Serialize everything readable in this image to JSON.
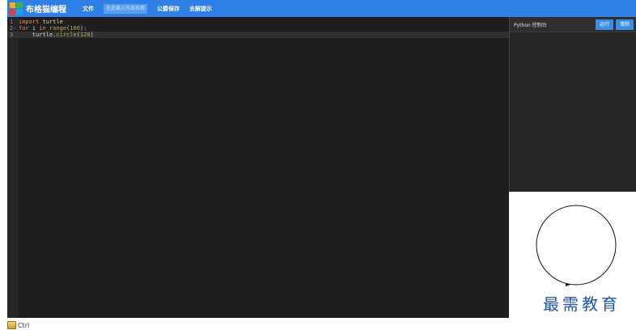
{
  "header": {
    "brand": "布格猫编程",
    "menu": [
      "文件",
      "公爵保存",
      "去解提示"
    ],
    "search_placeholder": "在此输入作品名称"
  },
  "editor": {
    "lines": [
      {
        "n": "1",
        "tokens": [
          [
            "kw",
            "import"
          ],
          [
            "pl",
            " "
          ],
          [
            "id",
            "turtle"
          ]
        ]
      },
      {
        "n": "2-",
        "tokens": [
          [
            "kw",
            "for"
          ],
          [
            "pl",
            " "
          ],
          [
            "id",
            "i"
          ],
          [
            "pl",
            " "
          ],
          [
            "kw",
            "in"
          ],
          [
            "pl",
            " "
          ],
          [
            "fn",
            "range"
          ],
          [
            "pl",
            "("
          ],
          [
            "num",
            "100"
          ],
          [
            "pl",
            "):"
          ]
        ]
      },
      {
        "n": "3",
        "tokens": [
          [
            "pl",
            "    "
          ],
          [
            "id",
            "turtle"
          ],
          [
            "pl",
            "."
          ],
          [
            "fn",
            "circle"
          ],
          [
            "pl",
            "("
          ],
          [
            "num",
            "120"
          ],
          [
            "pl",
            ")"
          ]
        ]
      }
    ]
  },
  "console": {
    "title": "Python 控制台",
    "run_label": "运行",
    "clear_label": "清除"
  },
  "canvas": {
    "watermark": "最需教育"
  },
  "taskbar": {
    "item_label": "Ctrl"
  }
}
